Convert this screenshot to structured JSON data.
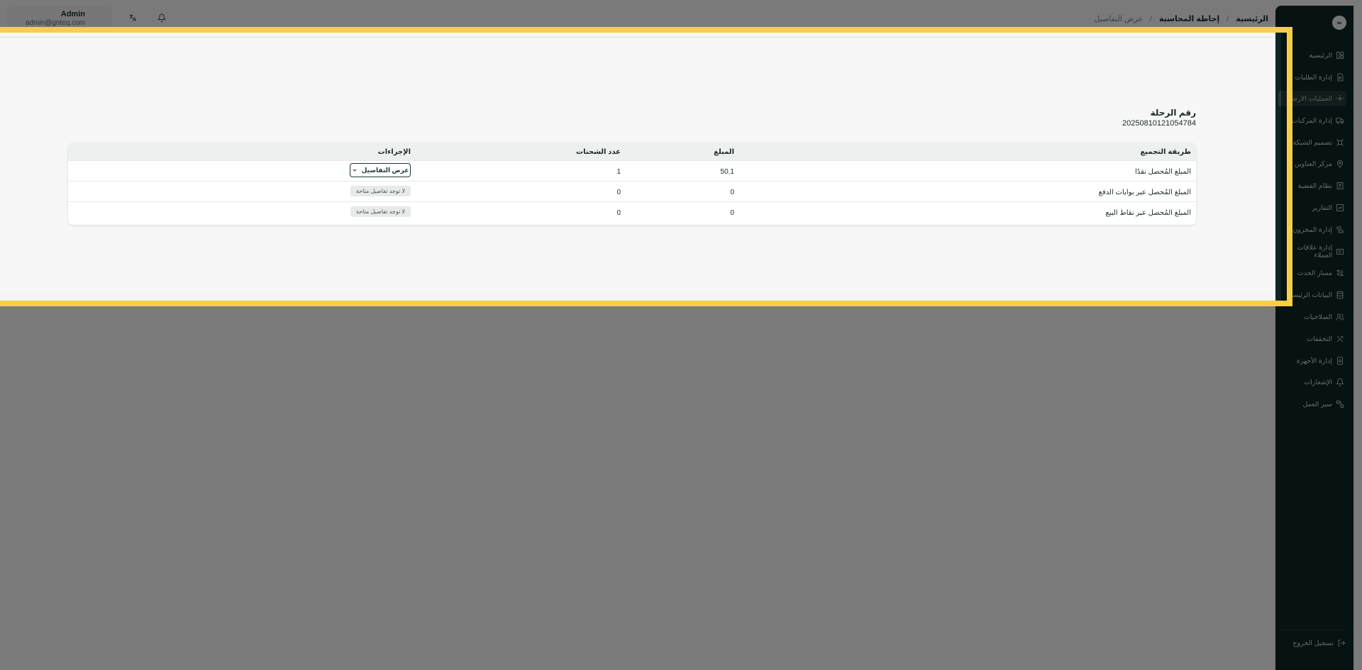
{
  "header": {
    "user_name": "Admin",
    "user_email": "admin@gnteq.com",
    "breadcrumb": {
      "home": "الرئيسية",
      "section": "إحاطة المحاسبة",
      "current": "عرض التفاصيل",
      "separator": "/"
    }
  },
  "trip": {
    "label": "رقم الرحلة",
    "number": "20250810121054784"
  },
  "table": {
    "headers": {
      "method": "طريقة التجميع",
      "amount": "المبلغ",
      "shipments": "عدد الشحنات",
      "actions": "الإجراءات"
    },
    "rows": [
      {
        "method": "المبلغ المُحصل نقدًا",
        "amount": "50.1",
        "shipments": "1",
        "action": "عرض التفاصيل"
      },
      {
        "method": "المبلغ المُحصل عبر بوابات الدفع",
        "amount": "0",
        "shipments": "0",
        "action": "لا توجد تفاصيل متاحة"
      },
      {
        "method": "المبلغ المُحصل عبر نقاط البيع",
        "amount": "0",
        "shipments": "0",
        "action": "لا توجد تفاصيل متاحة"
      }
    ]
  },
  "sidebar": {
    "logo": "∞",
    "items": [
      {
        "label": "الرئيسية",
        "icon": "layout-icon"
      },
      {
        "label": "إدارة الطلبات",
        "icon": "orders-icon"
      },
      {
        "label": "العمليات الارضية",
        "icon": "operations-icon"
      },
      {
        "label": "إدارة المركبات",
        "icon": "truck-icon"
      },
      {
        "label": "تصميم الشبكة",
        "icon": "network-icon"
      },
      {
        "label": "مركز العناوين",
        "icon": "location-icon"
      },
      {
        "label": "نظام القضية",
        "icon": "case-icon"
      },
      {
        "label": "التقارير",
        "icon": "chart-icon"
      },
      {
        "label": "إدارة المخزون",
        "icon": "inventory-icon"
      },
      {
        "label": "إدارة علاقات العملاء",
        "icon": "crm-icon"
      },
      {
        "label": "مسار الحدث",
        "icon": "route-icon"
      },
      {
        "label": "البيانات الرئيسية",
        "icon": "database-icon"
      },
      {
        "label": "الصلاحيات",
        "icon": "users-icon"
      },
      {
        "label": "التحققات",
        "icon": "tools-icon"
      },
      {
        "label": "إدارة الأجهزة",
        "icon": "device-icon"
      },
      {
        "label": "الإشعارات",
        "icon": "bell-icon"
      },
      {
        "label": "سير العمل",
        "icon": "workflow-icon"
      }
    ],
    "logout": "تسجيل الخروج"
  }
}
